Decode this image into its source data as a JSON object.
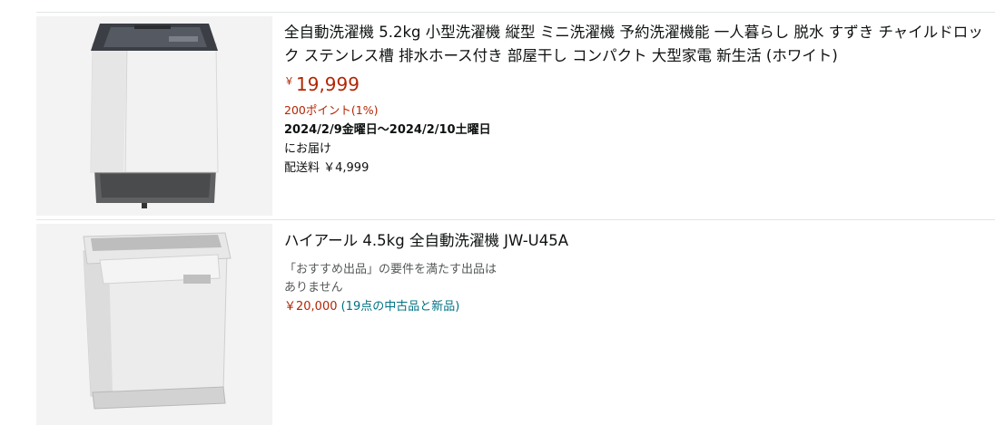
{
  "products": [
    {
      "title": "全自動洗濯機 5.2kg 小型洗濯機 縦型 ミニ洗濯機 予約洗濯機能 一人暮らし 脱水 すずき チャイルドロック ステンレス槽 排水ホース付き 部屋干し コンパクト 大型家電 新生活 (ホワイト)",
      "price_symbol": "￥",
      "price": "19,999",
      "points": "200ポイント(1%)",
      "delivery_date": "2024/2/9金曜日～2024/2/10土曜日",
      "delivery_suffix": "にお届け",
      "shipping": "配送料 ￥4,999",
      "image_icon": "washing-machine-top-load-dark-lid"
    },
    {
      "title": "ハイアール 4.5kg 全自動洗濯機 JW-U45A",
      "no_offer_line1": "「おすすめ出品」の要件を満たす出品は",
      "no_offer_line2": "ありません",
      "offer_price": "￥20,000",
      "offer_link": "(19点の中古品と新品)",
      "image_icon": "washing-machine-top-load-white"
    }
  ],
  "colors": {
    "price": "#b12704",
    "link": "#007185",
    "text": "#0f1111",
    "muted": "#565959",
    "image_bg": "#f3f3f3"
  }
}
